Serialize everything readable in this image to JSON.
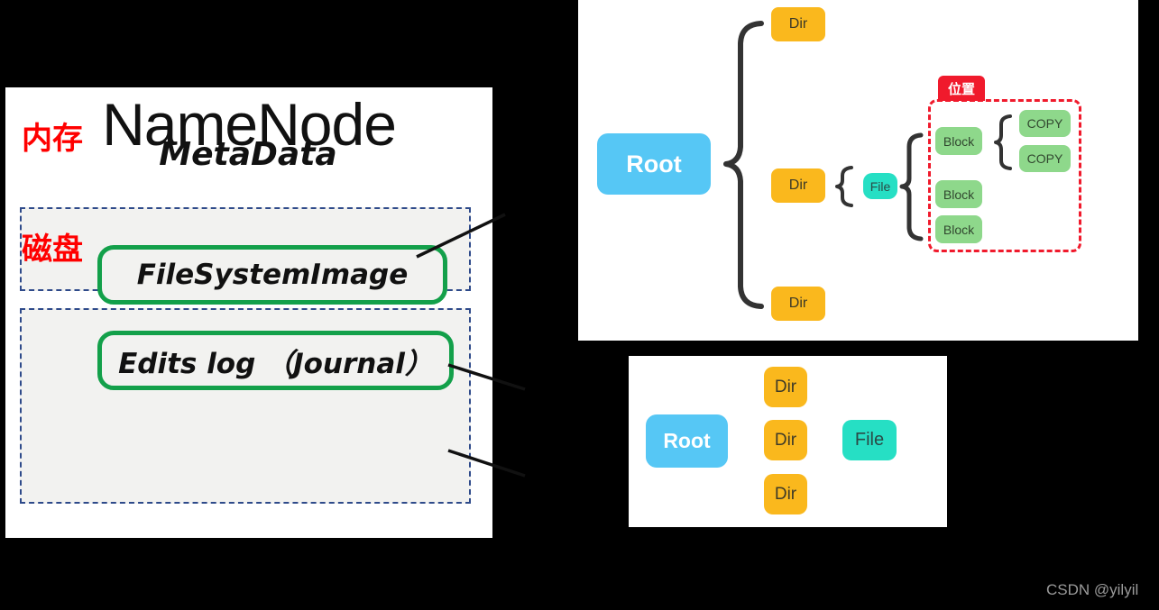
{
  "namenode": {
    "title": "NameNode",
    "memory_label": "内存",
    "disk_label": "磁盘",
    "metadata_label": "MetaData",
    "fsimage_label": "FileSystemImage",
    "editslog_label": "Edits log （Journal）"
  },
  "tree_top": {
    "root_label": "Root",
    "dir1_label": "Dir",
    "dir2_label": "Dir",
    "dir3_label": "Dir",
    "file_label": "File",
    "block1_label": "Block",
    "block2_label": "Block",
    "block3_label": "Block",
    "copy1_label": "COPY",
    "copy2_label": "COPY",
    "location_tab_label": "位置",
    "brace_root_glyph": "{",
    "brace_file_glyph": "{",
    "brace_block_glyph": "{"
  },
  "tree_bottom": {
    "root_label": "Root",
    "dir1_label": "Dir",
    "dir2_label": "Dir",
    "dir3_label": "Dir",
    "file_label": "File"
  },
  "watermark": {
    "text": "CSDN @yilyil"
  },
  "colors": {
    "background": "#000000",
    "panel": "#ffffff",
    "root_blue": "#56c7f5",
    "dir_yellow": "#fab81d",
    "file_teal": "#26dfc4",
    "block_green": "#8ed88b",
    "red_accent": "#f01a2c",
    "green_border": "#13a04a",
    "dashed_blue": "#2e4a8a",
    "chinese_red": "#ff0000",
    "group_fill": "#f2f2f0",
    "watermark_gray": "#9a9a9a"
  }
}
